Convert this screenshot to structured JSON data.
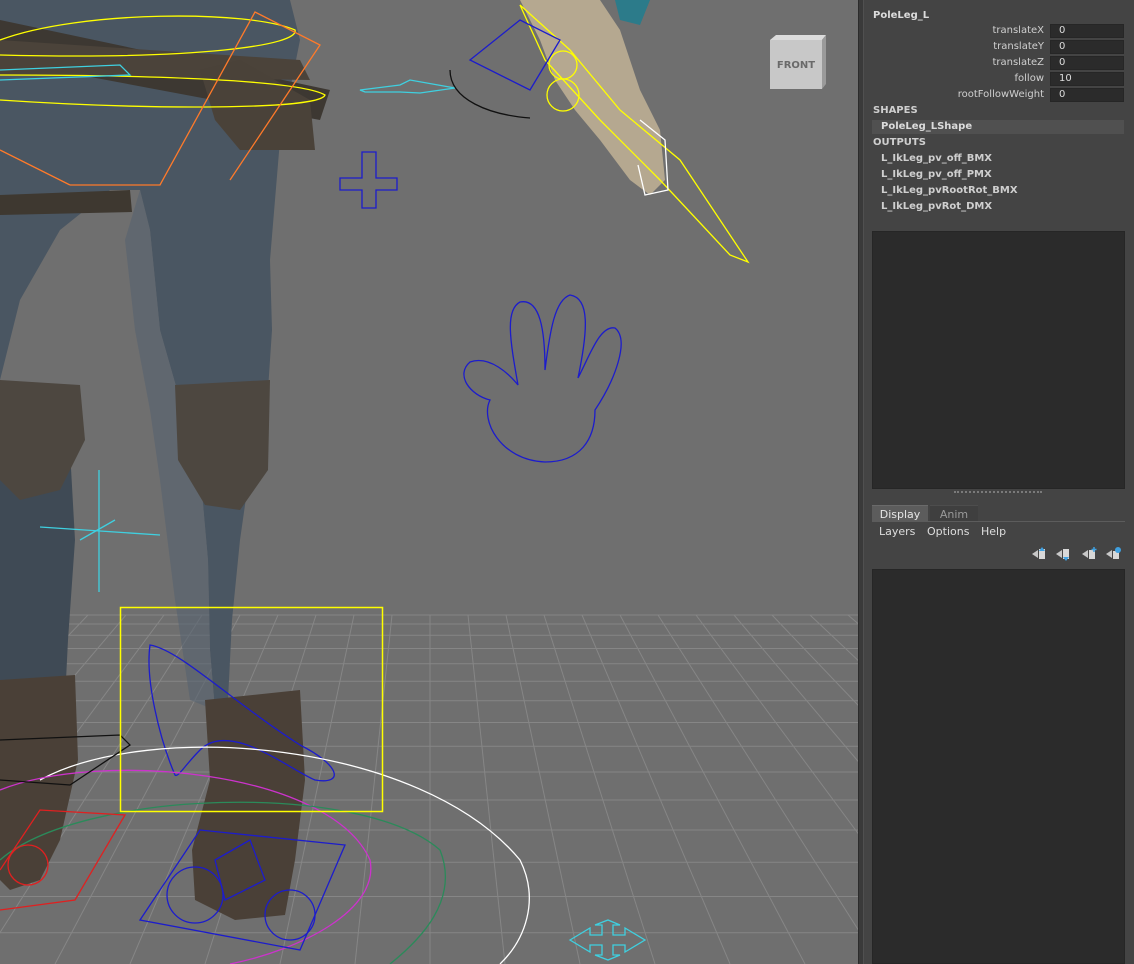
{
  "viewport": {
    "view_cube_label": "FRONT",
    "colors": {
      "background": "#6f6f6f",
      "grid": "#808080",
      "selection_box": "#ffff00",
      "control_blue": "#1c1ccc",
      "control_yellow": "#ffff00",
      "control_orange": "#ff7a2a",
      "control_cyan": "#3fd0e0",
      "control_white": "#ffffff"
    }
  },
  "attribute_editor": {
    "node_name": "PoleLeg_L",
    "attributes": [
      {
        "label": "translateX",
        "value": "0"
      },
      {
        "label": "translateY",
        "value": "0"
      },
      {
        "label": "translateZ",
        "value": "0"
      },
      {
        "label": "follow",
        "value": "10"
      },
      {
        "label": "rootFollowWeight",
        "value": "0"
      }
    ],
    "shapes_header": "SHAPES",
    "shapes": [
      "PoleLeg_LShape"
    ],
    "outputs_header": "OUTPUTS",
    "outputs": [
      "L_IkLeg_pv_off_BMX",
      "L_IkLeg_pv_off_PMX",
      "L_IkLeg_pvRootRot_BMX",
      "L_IkLeg_pvRot_DMX"
    ]
  },
  "layer_editor": {
    "tabs": [
      "Display",
      "Anim"
    ],
    "active_tab": "Display",
    "menu": [
      "Layers",
      "Options",
      "Help"
    ],
    "icons": [
      "move-layer-up-icon",
      "move-layer-down-icon",
      "new-layer-icon",
      "new-layer-from-selected-icon"
    ]
  }
}
